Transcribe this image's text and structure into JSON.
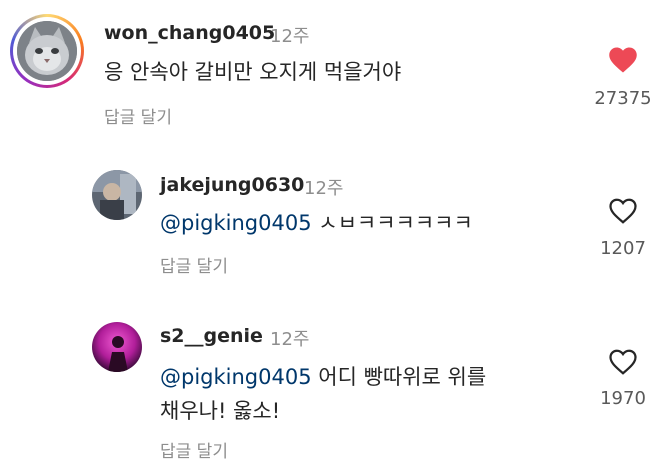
{
  "comments": [
    {
      "username": "won_chang0405",
      "time": "12주",
      "text": "응 안속아 갈비만 오지게 먹을거야",
      "reply_label": "답글 달기",
      "like_count": "27375",
      "liked": true
    },
    {
      "username": "jakejung0630",
      "time": "12주",
      "mention": "@pigking0405",
      "text": " ㅅㅂㅋㅋㅋㅋㅋㅋ",
      "reply_label": "답글 달기",
      "like_count": "1207",
      "liked": false
    },
    {
      "username": "s2__genie",
      "time": "12주",
      "mention": "@pigking0405",
      "text_line1": " 어디 빵따위로 위를",
      "text_line2": "채우나! 옳소!",
      "reply_label": "답글 달기",
      "like_count": "1970",
      "liked": false
    }
  ],
  "colors": {
    "heart_filled": "#ed4956",
    "heart_outline": "#262626",
    "mention": "#00376b",
    "muted": "#8e8e8e"
  },
  "icons": {
    "liked": "heart-filled-icon",
    "unliked": "heart-outline-icon"
  }
}
